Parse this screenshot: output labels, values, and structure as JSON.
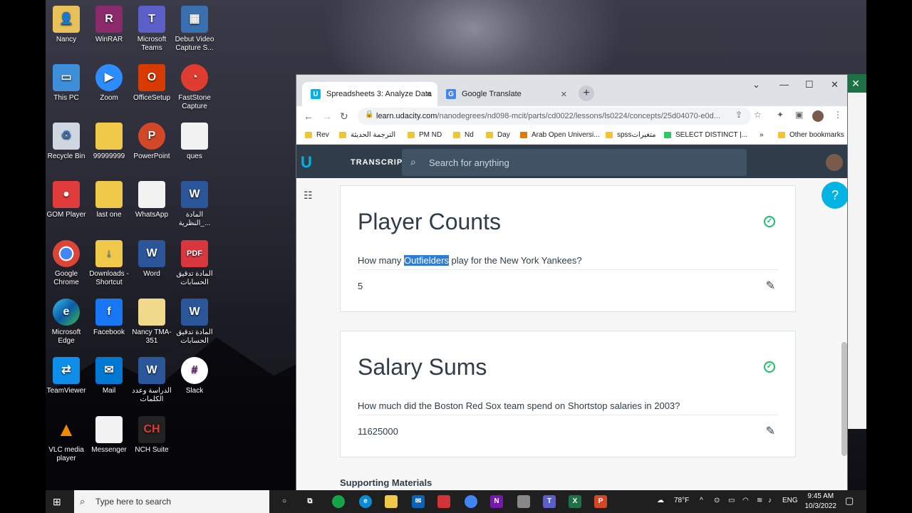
{
  "desktop": {
    "icons": [
      {
        "label": "Nancy"
      },
      {
        "label": "WinRAR"
      },
      {
        "label": "Microsoft Teams"
      },
      {
        "label": "Debut Video Capture S..."
      },
      {
        "label": "This PC"
      },
      {
        "label": "Zoom"
      },
      {
        "label": "OfficeSetup"
      },
      {
        "label": "FastStone Capture"
      },
      {
        "label": "Recycle Bin"
      },
      {
        "label": "99999999"
      },
      {
        "label": "PowerPoint"
      },
      {
        "label": "ques"
      },
      {
        "label": "GOM Player"
      },
      {
        "label": "last one"
      },
      {
        "label": "WhatsApp"
      },
      {
        "label": "المادة _النظرية..."
      },
      {
        "label": "Google Chrome"
      },
      {
        "label": "Downloads - Shortcut"
      },
      {
        "label": "Word"
      },
      {
        "label": "المادة تدقيق الحسابات"
      },
      {
        "label": "Microsoft Edge"
      },
      {
        "label": "Facebook"
      },
      {
        "label": "Nancy TMA-351"
      },
      {
        "label": "المادة تدقيق الحسابات"
      },
      {
        "label": "TeamViewer"
      },
      {
        "label": "Mail"
      },
      {
        "label": "الدراسة وعدد الكلمات"
      },
      {
        "label": "Slack"
      },
      {
        "label": "VLC media player"
      },
      {
        "label": "Messenger"
      },
      {
        "label": "NCH Suite"
      }
    ]
  },
  "browser": {
    "tabs": [
      {
        "label": "Spreadsheets 3: Analyze Data",
        "favicon": "U"
      },
      {
        "label": "Google Translate",
        "favicon": "G"
      }
    ],
    "url_host": "learn.udacity.com",
    "url_path": "/nanodegrees/nd098-mcit/parts/cd0022/lessons/ls0224/concepts/25d04070-e0d...",
    "bookmarks": [
      {
        "label": "Rev"
      },
      {
        "label": "الترجمة الحديثة"
      },
      {
        "label": "PM ND"
      },
      {
        "label": "Nd"
      },
      {
        "label": "Day"
      },
      {
        "label": "Arab Open Universi..."
      },
      {
        "label": "spssمتغيرات"
      },
      {
        "label": "SELECT DISTINCT |..."
      }
    ],
    "bookmarks_more": "»",
    "other_bookmarks": "Other bookmarks"
  },
  "udacity": {
    "transcript_label": "TRANSCRIPT",
    "search_placeholder": "Search for anything",
    "cards": [
      {
        "title": "Player Counts",
        "question_before": "How many ",
        "question_highlight": "Outfielders",
        "question_after": " play for the New York Yankees?",
        "answer": "5"
      },
      {
        "title": "Salary Sums",
        "question_before": "How much did the Boston Red Sox team spend on Shortstop salaries in 2003?",
        "question_highlight": "",
        "question_after": "",
        "answer": "11625000"
      }
    ],
    "supporting_materials": "Supporting Materials",
    "help_label": "?"
  },
  "taskbar": {
    "search_placeholder": "Type here to search",
    "weather": "78°F",
    "language": "ENG",
    "time": "9:45 AM",
    "date": "10/3/2022"
  },
  "colors": {
    "udacity_header": "#2e3d49",
    "udacity_accent": "#02b3e4",
    "check_green": "#15c26b",
    "highlight": "#2f7bd6"
  }
}
